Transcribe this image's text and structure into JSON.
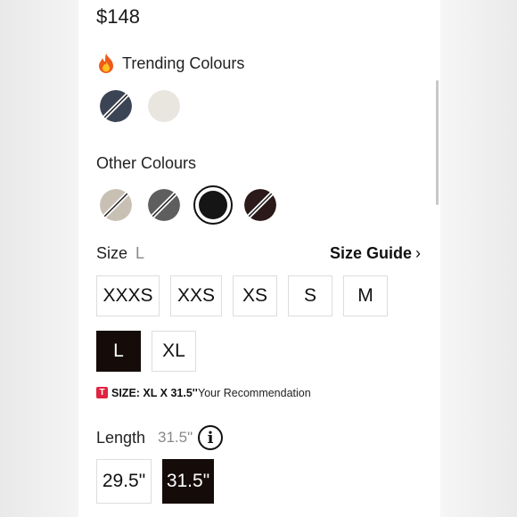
{
  "product": {
    "price": "$148"
  },
  "trending": {
    "icon": "flame-icon",
    "label": "Trending Colours",
    "swatches": [
      {
        "name": "navy",
        "color": "#3b4454",
        "unavailable": true
      },
      {
        "name": "cream",
        "color": "#e9e5df",
        "unavailable": false
      }
    ]
  },
  "other": {
    "label": "Other Colours",
    "swatches": [
      {
        "name": "beige",
        "color": "#c9c0b4",
        "unavailable": true
      },
      {
        "name": "grey",
        "color": "#5e5e5e",
        "unavailable": true
      },
      {
        "name": "black",
        "color": "#151515",
        "selected": true
      },
      {
        "name": "brown",
        "color": "#2b1a19",
        "unavailable": true
      }
    ]
  },
  "size": {
    "label": "Size",
    "selected": "L",
    "guide_label": "Size Guide",
    "guide_chevron": "›",
    "options": [
      "XXXS",
      "XXS",
      "XS",
      "S",
      "M",
      "L",
      "XL"
    ]
  },
  "recommendation": {
    "badge": "T",
    "size_text": "SIZE: XL X 31.5''",
    "text": "Your Recommendation"
  },
  "length": {
    "label": "Length",
    "selected": "31.5\"",
    "info_icon": "info-icon",
    "options": [
      "29.5\"",
      "31.5\""
    ]
  },
  "colors": {
    "selected_bg": "#150c0a",
    "recommend_red": "#e0233f"
  }
}
